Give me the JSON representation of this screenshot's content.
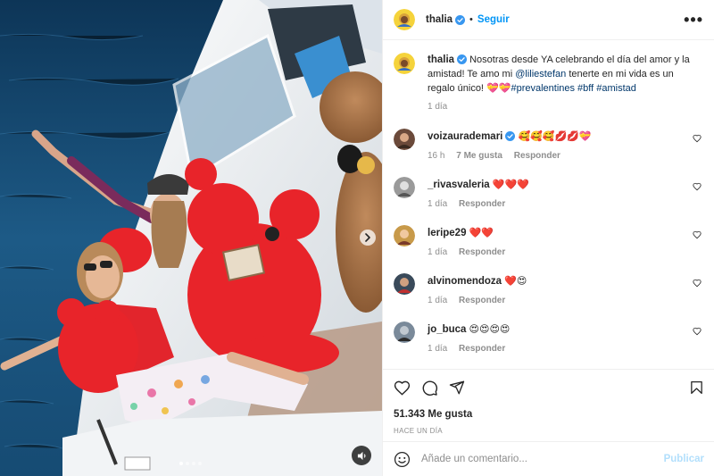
{
  "post": {
    "username": "thalia",
    "follow_label": "Seguir",
    "separator": "•",
    "more_label": "•••",
    "caption": {
      "username": "thalia",
      "text_1": " Nosotras desde YA celebrando el día del amor y la amistad! Te amo mi ",
      "mention": "@liliestefan",
      "text_2": " tenerte en mi vida es un regalo único! ",
      "emoji": "💝💝",
      "hashtags": "#prevalentines #bff #amistad",
      "time": "1 día"
    },
    "comments": [
      {
        "username": "voizaurademari",
        "text": "🥰🥰🥰💋💋💝",
        "time": "16 h",
        "likes": "7 Me gusta",
        "reply": "Responder"
      },
      {
        "username": "_rivasvaleria",
        "text": "❤️❤️❤️",
        "time": "1 día",
        "reply": "Responder"
      },
      {
        "username": "leripe29",
        "text": "❤️❤️",
        "time": "1 día",
        "reply": "Responder"
      },
      {
        "username": "alvinomendoza",
        "text": "❤️😍",
        "time": "1 día",
        "reply": "Responder"
      },
      {
        "username": "jo_buca",
        "text": "😍😍😍😍",
        "time": "1 día",
        "reply": "Responder"
      }
    ],
    "likes_count": "51.343 Me gusta",
    "posted_ago": "HACE UN DÍA",
    "comment_placeholder": "Añade un comentario...",
    "publish_label": "Publicar"
  },
  "colors": {
    "accent": "#0095f6",
    "link": "#00376b",
    "muted": "#8e8e8e",
    "publish_disabled": "#b2dffc"
  },
  "media": {
    "slide_count": 4,
    "active_slide": 1,
    "icons": [
      "chevron-right-icon",
      "speaker-icon"
    ]
  }
}
